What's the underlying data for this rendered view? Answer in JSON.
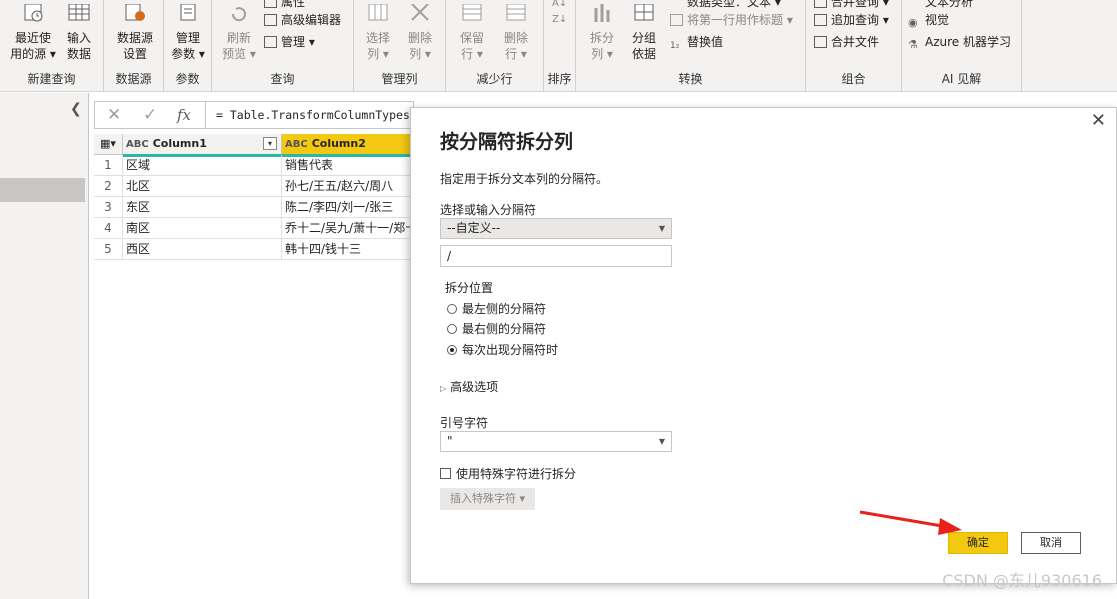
{
  "ribbon": {
    "groups": {
      "new_query": "新建查询",
      "data_source": "数据源",
      "params": "参数",
      "query": "查询",
      "manage_cols": "管理列",
      "reduce_rows": "减少行",
      "sort": "排序",
      "transform": "转换",
      "combine": "组合",
      "ai": "AI 见解"
    },
    "buttons": {
      "recent_sources_1": "最近使",
      "recent_sources_2": "用的源 ▾",
      "enter_data_1": "输入",
      "enter_data_2": "数据",
      "ds_settings_1": "数据源",
      "ds_settings_2": "设置",
      "manage_params_1": "管理",
      "manage_params_2": "参数 ▾",
      "refresh_1": "刷新",
      "refresh_2": "预览 ▾",
      "properties": "属性",
      "advanced_editor": "高级编辑器",
      "manage": "管理 ▾",
      "choose_cols_1": "选择",
      "choose_cols_2": "列 ▾",
      "remove_cols_1": "删除",
      "remove_cols_2": "列 ▾",
      "keep_rows_1": "保留",
      "keep_rows_2": "行 ▾",
      "remove_rows_1": "删除",
      "remove_rows_2": "行 ▾",
      "split_col_1": "拆分",
      "split_col_2": "列 ▾",
      "group_by_1": "分组",
      "group_by_2": "依据",
      "data_type": "数据类型：文本 ▾",
      "first_row_headers": "将第一行用作标题 ▾",
      "replace_values": "替换值",
      "merge_queries": "合并查询 ▾",
      "append_queries": "追加查询 ▾",
      "combine_files": "合并文件",
      "text_analytics": "文本分析",
      "vision": "视觉",
      "azure_ml": "Azure 机器学习"
    }
  },
  "formula": {
    "text": "= Table.TransformColumnTypes(源"
  },
  "grid": {
    "col1": "Column1",
    "col2": "Column2",
    "type_badge": "ABC",
    "rows": [
      {
        "n": "1",
        "c1": "区域",
        "c2": "销售代表"
      },
      {
        "n": "2",
        "c1": "北区",
        "c2": "孙七/王五/赵六/周八"
      },
      {
        "n": "3",
        "c1": "东区",
        "c2": "陈二/李四/刘一/张三"
      },
      {
        "n": "4",
        "c1": "南区",
        "c2": "乔十二/吴九/萧十一/郑十"
      },
      {
        "n": "5",
        "c1": "西区",
        "c2": "韩十四/钱十三"
      }
    ]
  },
  "dialog": {
    "title": "按分隔符拆分列",
    "description": "指定用于拆分文本列的分隔符。",
    "delimiter_label": "选择或输入分隔符",
    "delimiter_select": "--自定义--",
    "delimiter_value": "/",
    "split_at_label": "拆分位置",
    "radio_left": "最左侧的分隔符",
    "radio_right": "最右侧的分隔符",
    "radio_each": "每次出现分隔符时",
    "advanced": "高级选项",
    "quote_label": "引号字符",
    "quote_value": "\"",
    "special_chars": "使用特殊字符进行拆分",
    "insert_special": "插入特殊字符 ▾",
    "ok": "确定",
    "cancel": "取消"
  },
  "watermark": "CSDN @东儿930616",
  "colors": {
    "accent_yellow": "#f2c811",
    "header_green": "#2ab8a4",
    "arrow_red": "#e8221b"
  }
}
